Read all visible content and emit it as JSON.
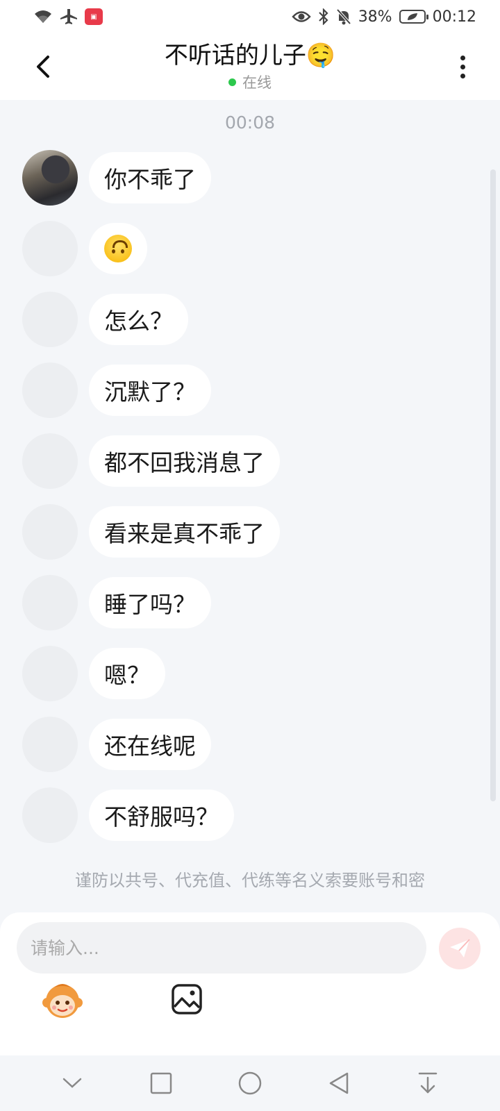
{
  "status_bar": {
    "battery": "38%",
    "time": "00:12",
    "icons": [
      "wifi-icon",
      "airplane-icon",
      "app-notification-icon",
      "eye-icon",
      "bluetooth-icon",
      "mute-icon",
      "battery-icon"
    ]
  },
  "header": {
    "title": "不听话的儿子",
    "title_emoji": "🤤",
    "status": "在线",
    "status_color": "#2dc84d"
  },
  "chat": {
    "time_divider": "00:08",
    "messages": [
      {
        "text": "你不乖了",
        "avatar": "photo"
      },
      {
        "text": "",
        "emoji": "upside-down-face-emoji"
      },
      {
        "text": "怎么？"
      },
      {
        "text": "沉默了？"
      },
      {
        "text": "都不回我消息了"
      },
      {
        "text": "看来是真不乖了"
      },
      {
        "text": "睡了吗？"
      },
      {
        "text": "嗯？"
      },
      {
        "text": "还在线呢"
      },
      {
        "text": "不舒服吗？"
      }
    ]
  },
  "notice": "谨防以共号、代充值、代练等名义索要账号和密",
  "composer": {
    "placeholder": "请输入...",
    "send_color": "#fde3e3"
  },
  "colors": {
    "background": "#f4f6f9",
    "bubble": "#ffffff",
    "accent": "#f25a5a"
  }
}
